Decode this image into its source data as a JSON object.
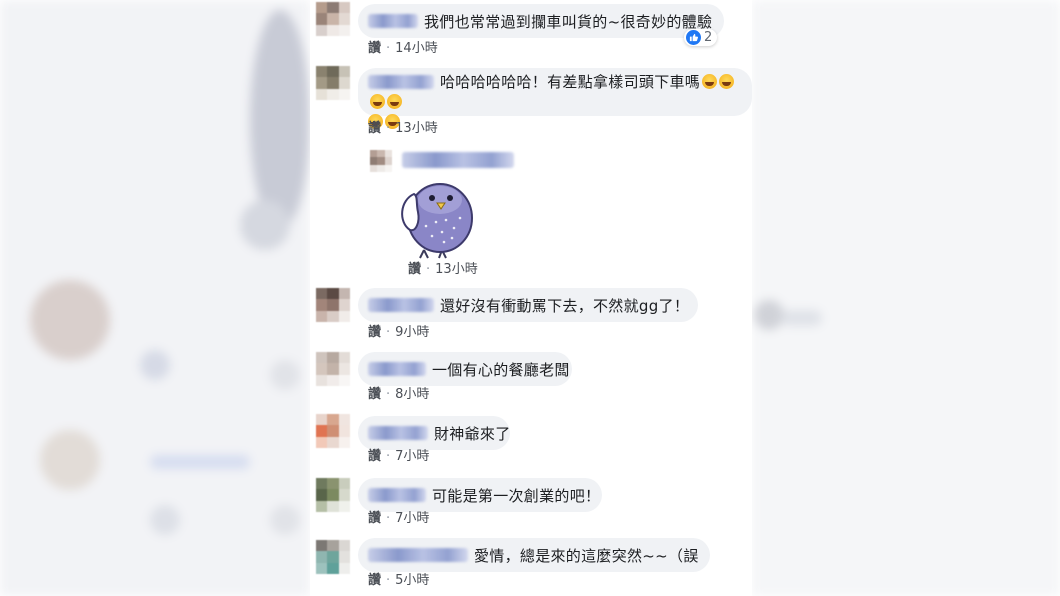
{
  "like_label": "讚",
  "comments": [
    {
      "text": "我們也常常過到攔車叫貨的~很奇妙的體驗",
      "time": "14小時",
      "reaction_count": "2",
      "emojis": 0
    },
    {
      "text": "哈哈哈哈哈哈！有差點拿樣司頭下車嗎",
      "time": "13小時",
      "emojis": 6
    },
    {
      "text": "",
      "time": "13小時",
      "sticker": "blue-bird-sticker"
    },
    {
      "text": "還好沒有衝動罵下去，不然就gg了！",
      "time": "9小時"
    },
    {
      "text": "一個有心的餐廳老闆",
      "time": "8小時"
    },
    {
      "text": "財神爺來了",
      "time": "7小時"
    },
    {
      "text": "可能是第一次創業的吧！",
      "time": "7小時"
    },
    {
      "text": "愛情，總是來的這麼突然~~（誤",
      "time": "5小時"
    }
  ],
  "colors": {
    "bubble": "#f0f2f5",
    "like_blue": "#2078f4",
    "text": "#1c1e21",
    "meta": "#4b4f56"
  },
  "icons": {
    "reaction": "thumbs-up-icon",
    "emoji": "laughing-emoji-icon"
  }
}
